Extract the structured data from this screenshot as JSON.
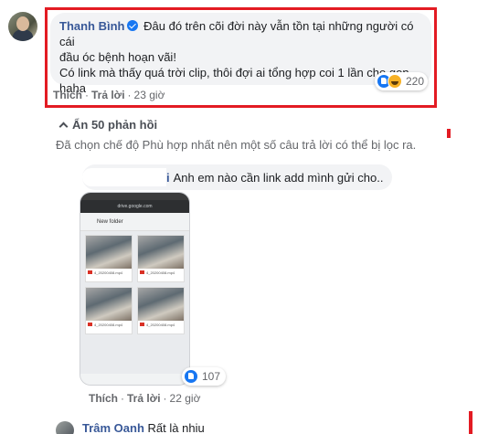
{
  "main_comment": {
    "author": "Thanh Bình",
    "line1": "Đâu đó trên cõi đời này vẫn tồn tại những người có cái",
    "line2": "đầu óc bệnh hoạn vãi!",
    "line3": "Có link mà thấy quá trời clip, thôi đợi ai tổng hợp coi 1 lần cho gọn",
    "line4": "haha",
    "reaction_count": "220",
    "action_like": "Thích",
    "action_reply": "Trả lời",
    "time": "23 giờ"
  },
  "replies_toggle": "Ẩn 50 phản hồi",
  "filter_note": "Đã chọn chế độ Phù hợp nhất nên một số câu trả lời có thể bị lọc ra.",
  "reply": {
    "author_tail": "i",
    "text": "Anh em nào cần link add mình gửi cho..",
    "reaction_count": "107",
    "action_like": "Thích",
    "action_reply": "Trả lời",
    "time": "22 giờ"
  },
  "phone_screenshot": {
    "url": "drive.google.com",
    "folder": "New folder",
    "file_name": "4_20200408.mp4"
  },
  "second_comment": {
    "author": "Trâm Oanh",
    "text": "Rất là nhiu"
  },
  "colors": {
    "highlight": "#e31b23",
    "author": "#385898",
    "bubble": "#f2f3f5",
    "meta": "#65676b"
  }
}
